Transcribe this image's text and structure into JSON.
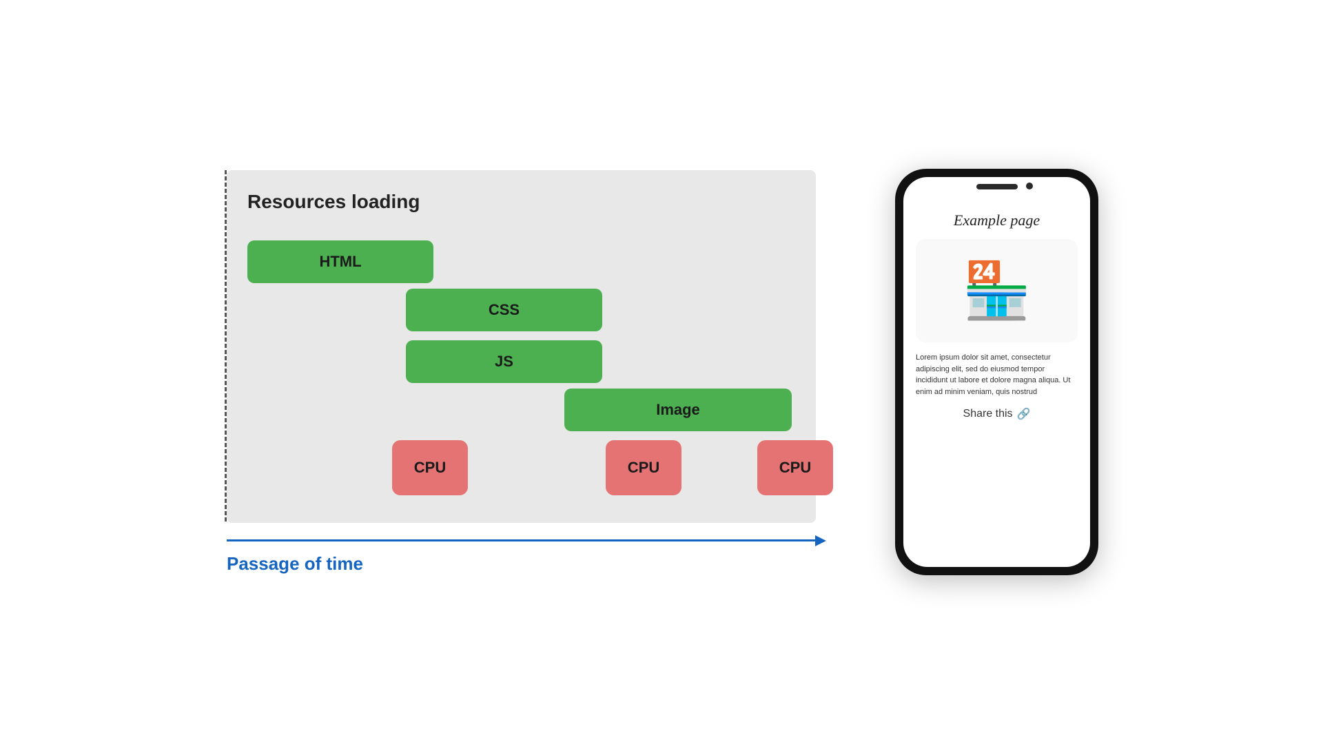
{
  "diagram": {
    "title": "Resources loading",
    "bars": [
      {
        "id": "html",
        "label": "HTML"
      },
      {
        "id": "css",
        "label": "CSS"
      },
      {
        "id": "js",
        "label": "JS"
      },
      {
        "id": "image",
        "label": "Image"
      }
    ],
    "cpu_boxes": [
      {
        "id": "cpu1",
        "label": "CPU"
      },
      {
        "id": "cpu2",
        "label": "CPU"
      },
      {
        "id": "cpu3",
        "label": "CPU"
      }
    ]
  },
  "timeline": {
    "label": "Passage of time"
  },
  "phone": {
    "page_title": "Example page",
    "card_icon": "🏪",
    "body_text": "Lorem ipsum dolor sit amet, consectetur adipiscing elit, sed do eiusmod tempor incididunt ut labore et dolore magna aliqua. Ut enim ad minim veniam, quis nostrud",
    "share_label": "Share this",
    "share_icon": "🔗"
  }
}
